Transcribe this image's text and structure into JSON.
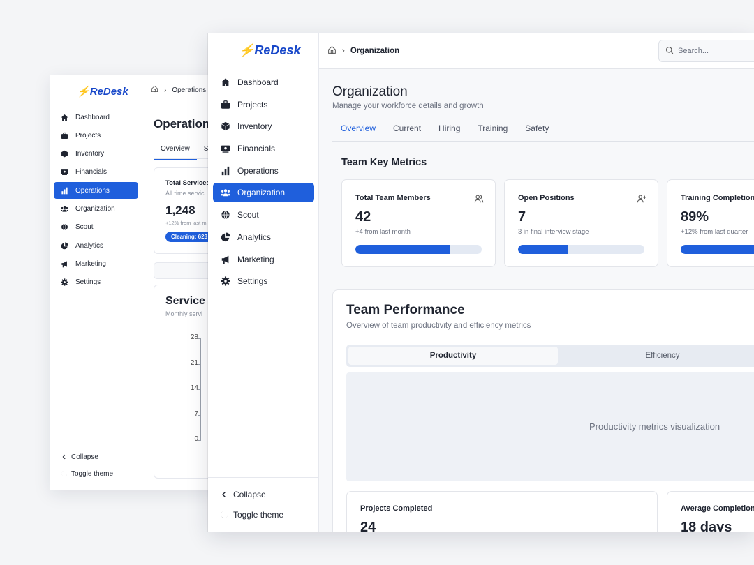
{
  "back_window": {
    "brand": "ReDesk",
    "breadcrumb": {
      "current": "Operations"
    },
    "nav": [
      {
        "label": "Dashboard",
        "icon": "home-icon"
      },
      {
        "label": "Projects",
        "icon": "briefcase-icon"
      },
      {
        "label": "Inventory",
        "icon": "box-icon"
      },
      {
        "label": "Financials",
        "icon": "banknote-icon"
      },
      {
        "label": "Operations",
        "icon": "bar-chart-icon",
        "active": true
      },
      {
        "label": "Organization",
        "icon": "users-icon"
      },
      {
        "label": "Scout",
        "icon": "globe-icon"
      },
      {
        "label": "Analytics",
        "icon": "pie-chart-icon"
      },
      {
        "label": "Marketing",
        "icon": "megaphone-icon"
      },
      {
        "label": "Settings",
        "icon": "gear-icon"
      }
    ],
    "collapse_label": "Collapse",
    "theme_label": "Toggle theme",
    "page_title": "Operation",
    "tabs": [
      {
        "label": "Overview",
        "active": true
      },
      {
        "label": "S"
      }
    ],
    "services_card": {
      "title": "Total Services",
      "subtitle": "All time servic",
      "value": "1,248",
      "delta": "+12% from last m",
      "pill": "Cleaning: 623"
    },
    "trend_card": {
      "title": "Service T",
      "subtitle": "Monthly servi",
      "y_ticks": [
        "28",
        "21",
        "14",
        "7",
        "0"
      ]
    }
  },
  "front_window": {
    "brand": "ReDesk",
    "breadcrumb": {
      "current": "Organization"
    },
    "search": {
      "placeholder": "Search..."
    },
    "nav": [
      {
        "label": "Dashboard",
        "icon": "home-icon"
      },
      {
        "label": "Projects",
        "icon": "briefcase-icon"
      },
      {
        "label": "Inventory",
        "icon": "box-icon"
      },
      {
        "label": "Financials",
        "icon": "banknote-icon"
      },
      {
        "label": "Operations",
        "icon": "bar-chart-icon"
      },
      {
        "label": "Organization",
        "icon": "users-icon",
        "active": true
      },
      {
        "label": "Scout",
        "icon": "globe-icon"
      },
      {
        "label": "Analytics",
        "icon": "pie-chart-icon"
      },
      {
        "label": "Marketing",
        "icon": "megaphone-icon"
      },
      {
        "label": "Settings",
        "icon": "gear-icon"
      }
    ],
    "collapse_label": "Collapse",
    "theme_label": "Toggle theme",
    "page": {
      "title": "Organization",
      "subtitle": "Manage your workforce details and growth",
      "tabs": [
        {
          "label": "Overview",
          "active": true
        },
        {
          "label": "Current"
        },
        {
          "label": "Hiring"
        },
        {
          "label": "Training"
        },
        {
          "label": "Safety"
        }
      ],
      "section_title": "Team Key Metrics",
      "metrics": [
        {
          "label": "Total Team Members",
          "value": "42",
          "delta": "+4 from last month",
          "progress": 0.75,
          "icon": "users-icon"
        },
        {
          "label": "Open Positions",
          "value": "7",
          "delta": "3 in final interview stage",
          "progress": 0.4,
          "icon": "user-plus-icon"
        },
        {
          "label": "Training Completion",
          "value": "89%",
          "delta": "+12% from last quarter",
          "progress": 0.89,
          "icon": "graduation-icon"
        }
      ],
      "performance": {
        "title": "Team Performance",
        "subtitle": "Overview of team productivity and efficiency metrics",
        "segments": [
          {
            "label": "Productivity",
            "active": true
          },
          {
            "label": "Efficiency"
          }
        ],
        "placeholder": "Productivity metrics visualization",
        "cards": [
          {
            "label": "Projects Completed",
            "value": "24"
          },
          {
            "label": "Average Completion",
            "value": "18 days"
          }
        ]
      }
    }
  },
  "colors": {
    "accent": "#1f5fdc",
    "brand": "#1747c9",
    "track": "#e3e9f3"
  }
}
